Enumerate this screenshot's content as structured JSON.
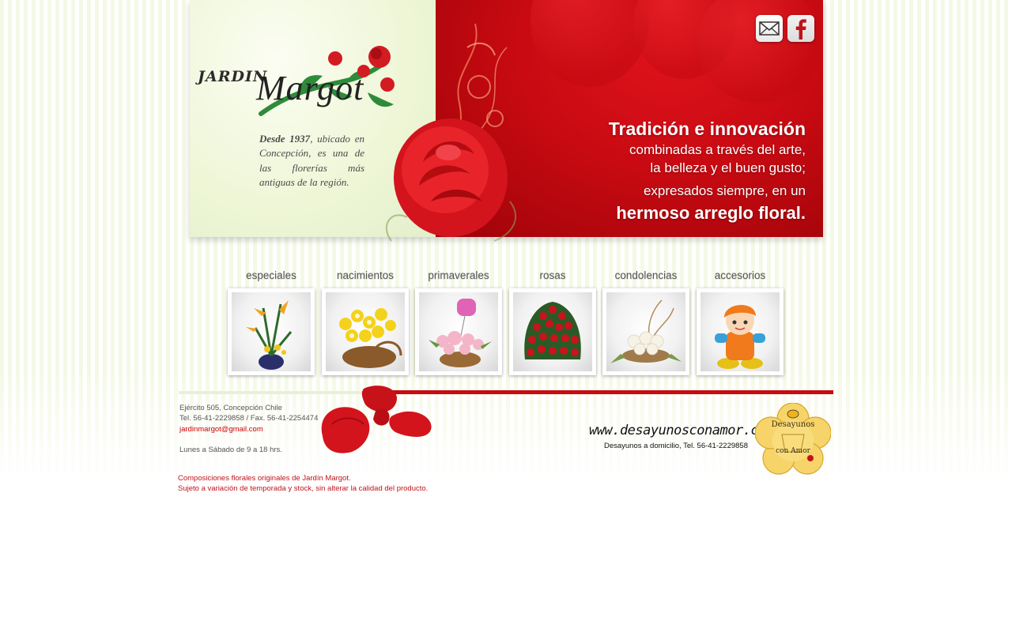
{
  "brand": {
    "jardin": "JARDIN",
    "margot": "Margot"
  },
  "intro": {
    "bold": "Desde 1937",
    "rest": ", ubicado en Concepción, es una de las florerías más antiguas de la región."
  },
  "slogan": {
    "line1": "Tradición e innovación",
    "line2": "combinadas a través del arte,",
    "line3": "la belleza y el buen gusto;",
    "line4": "expresados siempre, en un",
    "line5_bold": "hermoso arreglo floral",
    "line5_dot": "."
  },
  "social": {
    "mail_icon": "mail-icon",
    "facebook_icon": "facebook-icon"
  },
  "categories": [
    {
      "label": "especiales"
    },
    {
      "label": "nacimientos"
    },
    {
      "label": "primaverales"
    },
    {
      "label": "rosas"
    },
    {
      "label": "condolencias"
    },
    {
      "label": "accesorios"
    }
  ],
  "contact": {
    "address": "Ejército 505, Concepción Chile",
    "phone": "Tel. 56-41-2229858 / Fax. 56-41-2254474",
    "email": "jardinmargot@gmail.com",
    "hours": "Lunes a Sábado de 9 a 18 hrs."
  },
  "promo": {
    "site": "www.desayunosconamor.cl",
    "subtitle": "Desayunos a domicilio, Tel. 56-41-2229858",
    "badge_line1": "Desayunos",
    "badge_line2": "con Amor"
  },
  "disclaimer": {
    "line1": "Composiciones florales originales de Jardín Margot.",
    "line2": "Sujeto a variación de temporada y stock, sin alterar la calidad del producto."
  },
  "colors": {
    "brand_red": "#c70b12",
    "leaf_green": "#2e8b3a"
  }
}
